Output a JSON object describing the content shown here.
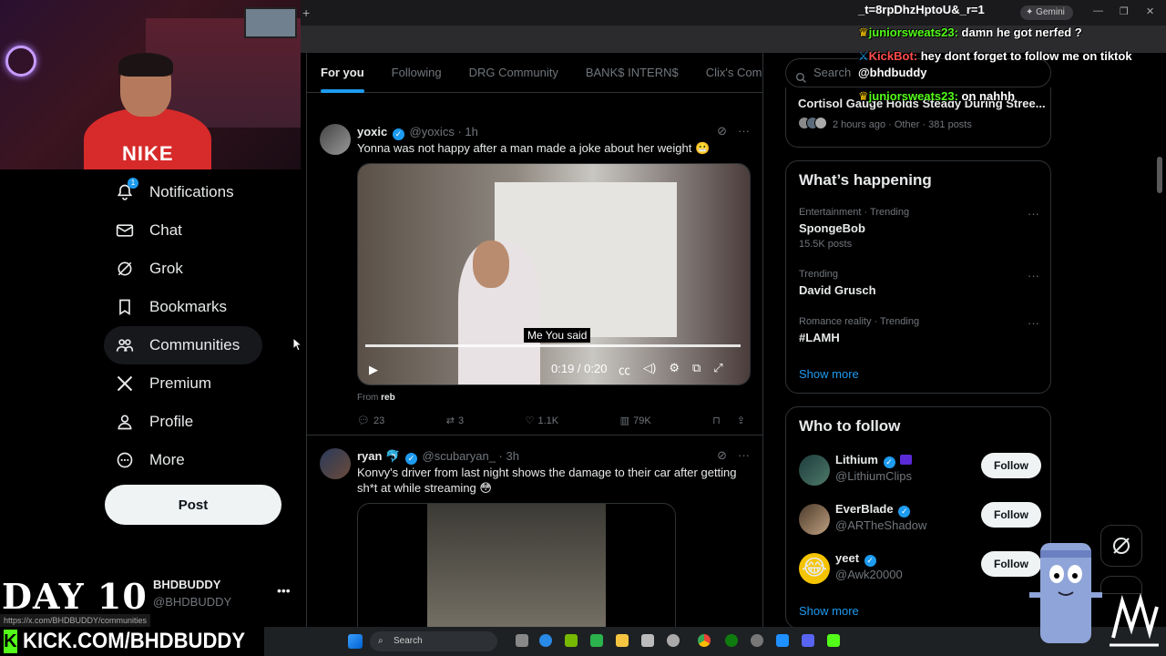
{
  "browser": {
    "url_fragment": "_t=8rpDhzHptoU&_r=1",
    "gemini_label": "Gemini"
  },
  "stream": {
    "day_label": "DAY 10",
    "kick_url": "KICK.COM/BHDBUDDY",
    "status_url": "https://x.com/BHDBUDDY/communities",
    "webcam_shirt": "NIKE",
    "chat": [
      {
        "user": "juniorsweats23:",
        "message": "damn he got nerfed ?",
        "kind": "user"
      },
      {
        "user": "KickBot:",
        "message": "hey dont forget to follow me on tiktok",
        "kind": "bot"
      },
      {
        "user": "",
        "message": "@bhdbuddy",
        "kind": "cont"
      },
      {
        "user": "juniorsweats23:",
        "message": "on nahhh",
        "kind": "user"
      }
    ]
  },
  "nav": {
    "notifications_badge": "1",
    "items": [
      {
        "label": "Notifications",
        "icon": "bell-icon"
      },
      {
        "label": "Chat",
        "icon": "mail-icon"
      },
      {
        "label": "Grok",
        "icon": "grok-icon"
      },
      {
        "label": "Bookmarks",
        "icon": "bookmark-icon"
      },
      {
        "label": "Communities",
        "icon": "people-icon"
      },
      {
        "label": "Premium",
        "icon": "x-logo-icon"
      },
      {
        "label": "Profile",
        "icon": "person-icon"
      },
      {
        "label": "More",
        "icon": "more-circle-icon"
      }
    ],
    "post_label": "Post",
    "account_name": "BHDBUDDY",
    "account_handle": "@BHDBUDDY"
  },
  "timeline": {
    "tabs": [
      "For you",
      "Following",
      "DRG Community",
      "BANK$ INTERN$",
      "Clix's Commu"
    ],
    "tweets": [
      {
        "name": "yoxic",
        "handle": "@yoxics",
        "time": "· 1h",
        "text": "Yonna was not happy after a man made a joke about her weight 😬",
        "video_caption": "Me You said",
        "video_time": "0:19 / 0:20",
        "from_prefix": "From",
        "from_name": "reb",
        "replies": "23",
        "reposts": "3",
        "likes": "1.1K",
        "views": "79K"
      },
      {
        "name": "ryan 🐬",
        "handle": "@scubaryan_",
        "time": "· 3h",
        "text": "Konvy's driver from last night shows the damage to their car after getting sh*t at while streaming 😳"
      }
    ]
  },
  "sidebar": {
    "search_placeholder": "Search",
    "top_trend": {
      "topic": "Cortisol Gauge Holds Steady During Stree...",
      "meta": "2 hours ago · Other · 381 posts"
    },
    "happening_title": "What’s happening",
    "trends": [
      {
        "meta": "Entertainment · Trending",
        "topic": "SpongeBob",
        "count": "15.5K posts"
      },
      {
        "meta": "Trending",
        "topic": "David Grusch",
        "count": ""
      },
      {
        "meta": "Romance reality · Trending",
        "topic": "#LAMH",
        "count": ""
      }
    ],
    "show_more": "Show more",
    "who_title": "Who to follow",
    "who": [
      {
        "name": "Lithium",
        "handle": "@LithiumClips",
        "button": "Follow"
      },
      {
        "name": "EverBlade",
        "handle": "@ARTheShadow",
        "button": "Follow"
      },
      {
        "name": "yeet",
        "handle": "@Awk20000",
        "button": "Follow"
      }
    ],
    "who_show_more": "Show more"
  },
  "taskbar": {
    "search_label": "Search"
  },
  "colors": {
    "accent": "#1d9bf0",
    "background": "#000000",
    "kick_green": "#53fc18"
  }
}
